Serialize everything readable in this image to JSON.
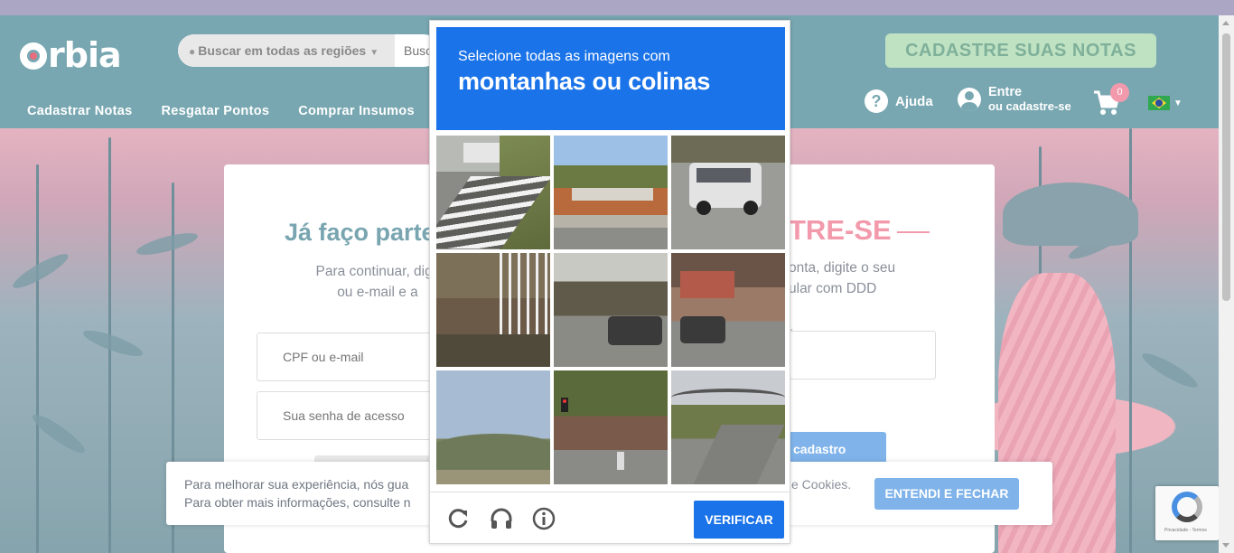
{
  "header": {
    "logo": "orbia",
    "search": {
      "region_label": "Buscar em todas as regiões",
      "placeholder": "Busc"
    },
    "cta_label": "CADASTRE SUAS NOTAS",
    "nav": [
      "Cadastrar Notas",
      "Resgatar Pontos",
      "Comprar Insumos"
    ],
    "help_label": "Ajuda",
    "account": {
      "line1": "Entre",
      "line2": "ou cadastre-se"
    },
    "cart_count": "0"
  },
  "login": {
    "title": "Já faço parte",
    "desc_line1": "Para continuar, digit",
    "desc_line2": "ou e-mail e a",
    "cpf_placeholder": "CPF ou e-mail",
    "password_placeholder": "Sua senha de acesso"
  },
  "signup": {
    "title": "TRE-SE",
    "desc_line1": "onta, digite o seu",
    "desc_line2": "ular com DDD",
    "field_hint": "r",
    "button_label": "cadastro"
  },
  "cookie": {
    "line1": "Para melhorar sua experiência, nós gua",
    "line2": "Para obter mais informações, consulte n",
    "line1_tail": "e Cookies.",
    "button_label": "ENTENDI E FECHAR"
  },
  "captcha": {
    "instruction": "Selecione todas as imagens com",
    "target": "montanhas ou colinas",
    "verify_label": "VERIFICAR",
    "tiles": [
      "crosswalk",
      "road-barrier",
      "white-suv",
      "stairs-house",
      "parking-car",
      "storefront",
      "hills-sky",
      "traffic-light",
      "road-hill"
    ]
  },
  "recaptcha_badge": {
    "text": "Privacidade - Termos"
  },
  "colors": {
    "header_bg": "#78a7b1",
    "accent_pink": "#f29aac",
    "captcha_blue": "#1a73e8",
    "cta_green": "#bfe2c2"
  }
}
